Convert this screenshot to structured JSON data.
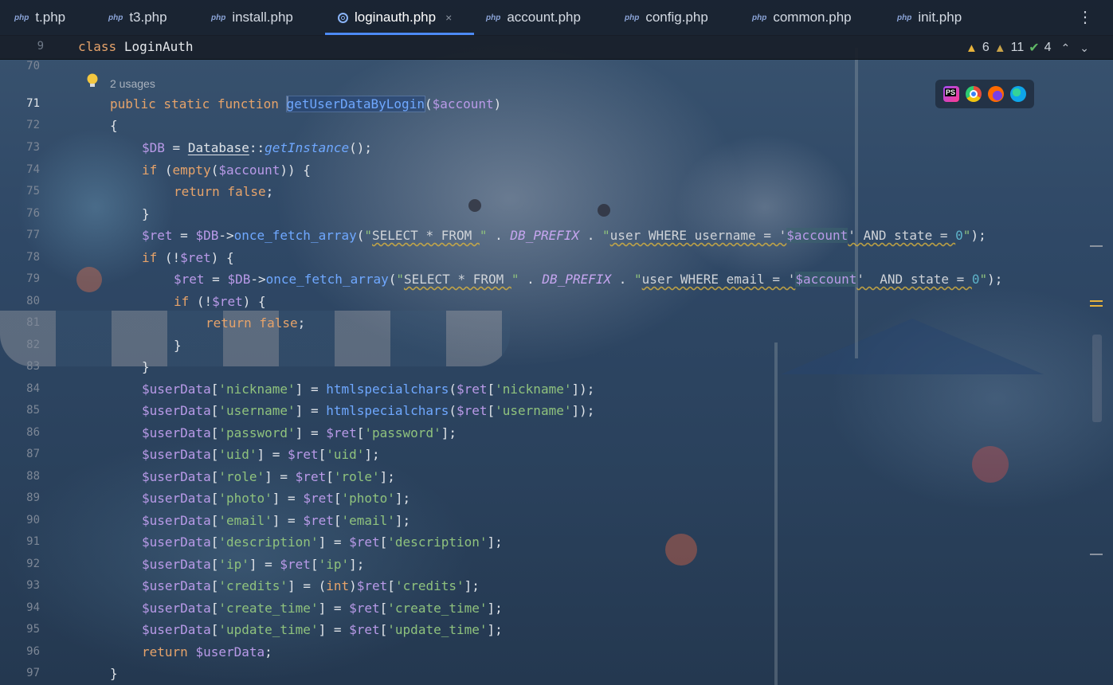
{
  "tabs": [
    {
      "label": "t.php",
      "icon": "php-file-icon"
    },
    {
      "label": "t3.php",
      "icon": "php-file-icon"
    },
    {
      "label": "install.php",
      "icon": "php-file-icon"
    },
    {
      "label": "loginauth.php",
      "icon": "php-class-icon",
      "active": true
    },
    {
      "label": "account.php",
      "icon": "php-file-icon"
    },
    {
      "label": "config.php",
      "icon": "php-file-icon"
    },
    {
      "label": "common.php",
      "icon": "php-file-icon"
    },
    {
      "label": "init.php",
      "icon": "php-file-icon"
    }
  ],
  "php_icon_text": "php",
  "close_glyph": "×",
  "more_glyph": "⋮",
  "sticky": {
    "line": "9",
    "keyword": "class",
    "name": "LoginAuth"
  },
  "inspections": {
    "warnings": "6",
    "weak_warnings": "11",
    "ok": "4"
  },
  "usages": "2 usages",
  "line_numbers": [
    "70",
    "71",
    "72",
    "73",
    "74",
    "75",
    "76",
    "77",
    "78",
    "79",
    "80",
    "81",
    "82",
    "83",
    "84",
    "85",
    "86",
    "87",
    "88",
    "89",
    "90",
    "91",
    "92",
    "93",
    "94",
    "95",
    "96",
    "97"
  ],
  "current_line": "71",
  "browsers": [
    "phpstorm-icon",
    "chrome-icon",
    "firefox-icon",
    "edge-icon"
  ],
  "colors": {
    "accent": "#4c8af5",
    "keyword": "#e6a36a",
    "function": "#6fa8ff",
    "variable": "#b99ae8",
    "string": "#8fc27d"
  }
}
